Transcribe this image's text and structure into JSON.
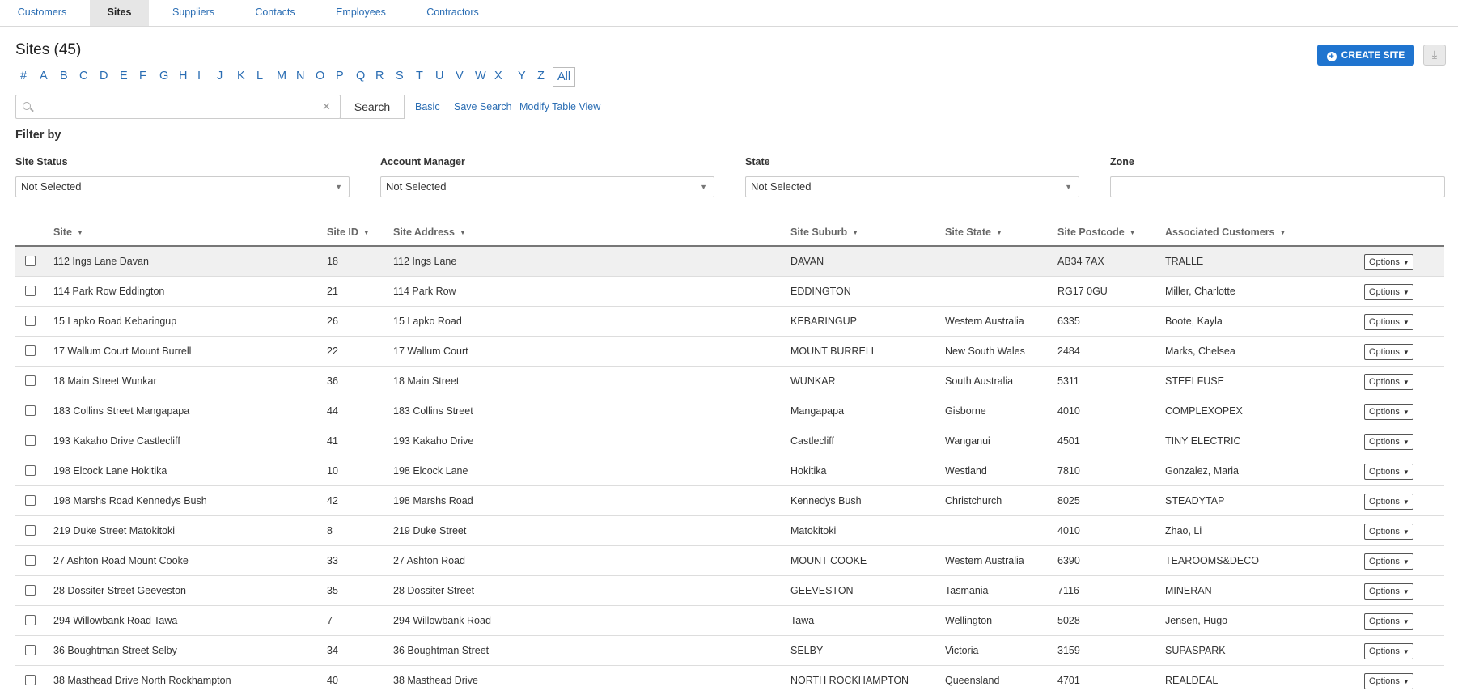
{
  "tabs": [
    {
      "label": "Customers"
    },
    {
      "label": "Sites"
    },
    {
      "label": "Suppliers"
    },
    {
      "label": "Contacts"
    },
    {
      "label": "Employees"
    },
    {
      "label": "Contractors"
    }
  ],
  "active_tab": "Sites",
  "page_title": "Sites (45)",
  "create_button": "CREATE SITE",
  "download_icon": "download-icon",
  "alphabet": [
    "#",
    "A",
    "B",
    "C",
    "D",
    "E",
    "F",
    "G",
    "H",
    "I",
    "J",
    "K",
    "L",
    "M",
    "N",
    "O",
    "P",
    "Q",
    "R",
    "S",
    "T",
    "U",
    "V",
    "W",
    "X",
    "Y",
    "Z",
    "All"
  ],
  "alphabet_selected": "All",
  "search": {
    "value": "",
    "button": "Search",
    "links": [
      "Basic",
      "Save Search",
      "Modify Table View"
    ]
  },
  "filters": {
    "title": "Filter by",
    "site_status": {
      "label": "Site Status",
      "value": "Not Selected"
    },
    "account_manager": {
      "label": "Account Manager",
      "value": "Not Selected"
    },
    "state": {
      "label": "State",
      "value": "Not Selected"
    },
    "zone": {
      "label": "Zone",
      "value": ""
    }
  },
  "table": {
    "columns": [
      "Site",
      "Site ID",
      "Site Address",
      "Site Suburb",
      "Site State",
      "Site Postcode",
      "Associated Customers"
    ],
    "options_label": "Options",
    "rows": [
      {
        "site": "112 Ings Lane Davan",
        "id": "18",
        "address": "112 Ings Lane",
        "suburb": "DAVAN",
        "state": "",
        "postcode": "AB34 7AX",
        "customers": "TRALLE"
      },
      {
        "site": "114 Park Row Eddington",
        "id": "21",
        "address": "114 Park Row",
        "suburb": "EDDINGTON",
        "state": "",
        "postcode": "RG17 0GU",
        "customers": "Miller, Charlotte"
      },
      {
        "site": "15 Lapko Road Kebaringup",
        "id": "26",
        "address": "15 Lapko Road",
        "suburb": "KEBARINGUP",
        "state": "Western Australia",
        "postcode": "6335",
        "customers": "Boote, Kayla"
      },
      {
        "site": "17 Wallum Court Mount Burrell",
        "id": "22",
        "address": "17 Wallum Court",
        "suburb": "MOUNT BURRELL",
        "state": "New South Wales",
        "postcode": "2484",
        "customers": "Marks, Chelsea"
      },
      {
        "site": "18 Main Street Wunkar",
        "id": "36",
        "address": "18 Main Street",
        "suburb": "WUNKAR",
        "state": "South Australia",
        "postcode": "5311",
        "customers": "STEELFUSE"
      },
      {
        "site": "183 Collins Street Mangapapa",
        "id": "44",
        "address": "183 Collins Street",
        "suburb": "Mangapapa",
        "state": "Gisborne",
        "postcode": "4010",
        "customers": "COMPLEXOPEX"
      },
      {
        "site": "193 Kakaho Drive Castlecliff",
        "id": "41",
        "address": "193 Kakaho Drive",
        "suburb": "Castlecliff",
        "state": "Wanganui",
        "postcode": "4501",
        "customers": "TINY ELECTRIC"
      },
      {
        "site": "198 Elcock Lane Hokitika",
        "id": "10",
        "address": "198 Elcock Lane",
        "suburb": "Hokitika",
        "state": "Westland",
        "postcode": "7810",
        "customers": "Gonzalez, Maria"
      },
      {
        "site": "198 Marshs Road Kennedys Bush",
        "id": "42",
        "address": "198 Marshs Road",
        "suburb": "Kennedys Bush",
        "state": "Christchurch",
        "postcode": "8025",
        "customers": "STEADYTAP"
      },
      {
        "site": "219 Duke Street Matokitoki",
        "id": "8",
        "address": "219 Duke Street",
        "suburb": "Matokitoki",
        "state": "",
        "postcode": "4010",
        "customers": "Zhao, Li"
      },
      {
        "site": "27 Ashton Road Mount Cooke",
        "id": "33",
        "address": "27 Ashton Road",
        "suburb": "MOUNT COOKE",
        "state": "Western Australia",
        "postcode": "6390",
        "customers": "TEAROOMS&DECO"
      },
      {
        "site": "28 Dossiter Street Geeveston",
        "id": "35",
        "address": "28 Dossiter Street",
        "suburb": "GEEVESTON",
        "state": "Tasmania",
        "postcode": "7116",
        "customers": "MINERAN"
      },
      {
        "site": "294 Willowbank Road Tawa",
        "id": "7",
        "address": "294 Willowbank Road",
        "suburb": "Tawa",
        "state": "Wellington",
        "postcode": "5028",
        "customers": "Jensen, Hugo"
      },
      {
        "site": "36 Boughtman Street Selby",
        "id": "34",
        "address": "36 Boughtman Street",
        "suburb": "SELBY",
        "state": "Victoria",
        "postcode": "3159",
        "customers": "SUPASPARK"
      },
      {
        "site": "38 Masthead Drive North Rockhampton",
        "id": "40",
        "address": "38 Masthead Drive",
        "suburb": "NORTH ROCKHAMPTON",
        "state": "Queensland",
        "postcode": "4701",
        "customers": "REALDEAL"
      }
    ]
  }
}
